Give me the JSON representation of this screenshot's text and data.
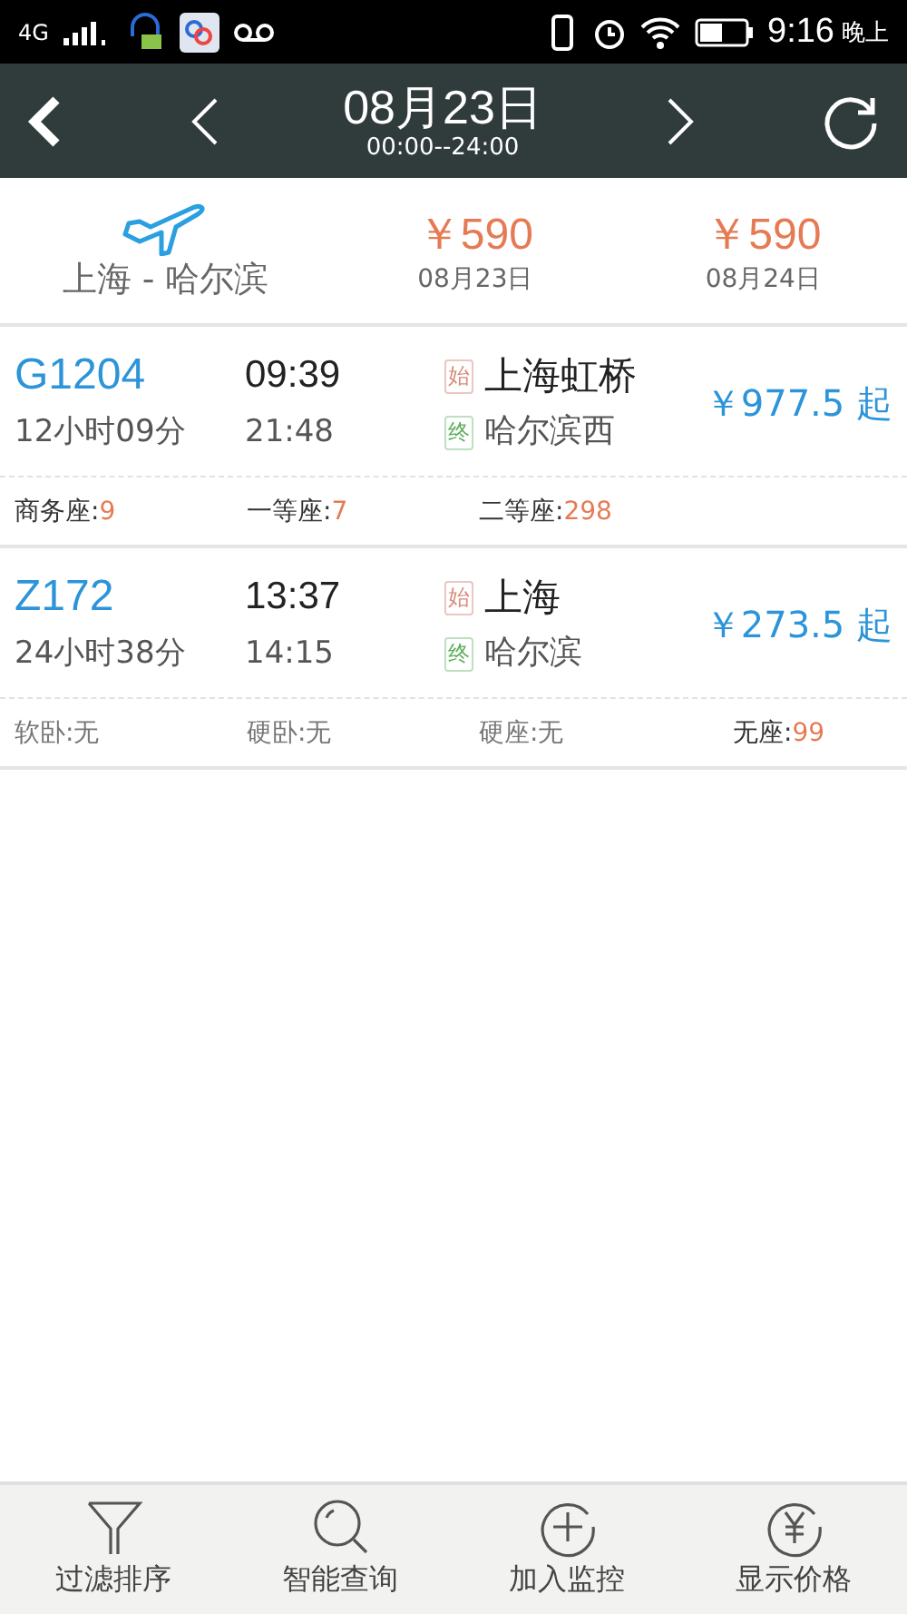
{
  "status_bar": {
    "network": "4G",
    "time": "9:16",
    "period": "晚上"
  },
  "header": {
    "date": "08月23日",
    "time_range": "00:00--24:00"
  },
  "flight": {
    "route": "上海 - 哈尔滨",
    "fares": [
      {
        "price": "￥590",
        "date": "08月23日"
      },
      {
        "price": "￥590",
        "date": "08月24日"
      }
    ]
  },
  "trains": [
    {
      "number": "G1204",
      "duration": "12小时09分",
      "depart": "09:39",
      "arrive": "21:48",
      "from_tag": "始",
      "from": "上海虹桥",
      "to_tag": "终",
      "to": "哈尔滨西",
      "price": "￥977.5 起",
      "seats": [
        {
          "label": "商务座:",
          "value": "9",
          "available": true
        },
        {
          "label": "一等座:",
          "value": "7",
          "available": true
        },
        {
          "label": "二等座:",
          "value": "298",
          "available": true
        }
      ]
    },
    {
      "number": "Z172",
      "duration": "24小时38分",
      "depart": "13:37",
      "arrive": "14:15",
      "from_tag": "始",
      "from": "上海",
      "to_tag": "终",
      "to": "哈尔滨",
      "price": "￥273.5 起",
      "seats": [
        {
          "label": "软卧:",
          "value": "无",
          "available": false
        },
        {
          "label": "硬卧:",
          "value": "无",
          "available": false
        },
        {
          "label": "硬座:",
          "value": "无",
          "available": false
        },
        {
          "label": "无座:",
          "value": "99",
          "available": true
        }
      ]
    }
  ],
  "toolbar": [
    {
      "kind": "filter",
      "label": "过滤排序"
    },
    {
      "kind": "search",
      "label": "智能查询"
    },
    {
      "kind": "add",
      "label": "加入监控"
    },
    {
      "kind": "yen",
      "label": "显示价格"
    }
  ]
}
